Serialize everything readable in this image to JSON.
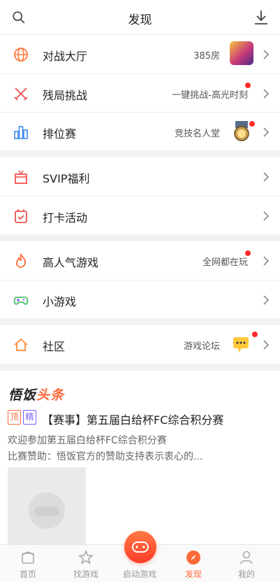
{
  "header": {
    "title": "发现",
    "search_icon": "search-icon",
    "download_icon": "download-icon"
  },
  "groups": [
    {
      "items": [
        {
          "label": "对战大厅",
          "sub": "385房",
          "icon": "globe-icon",
          "thumb": "game-thumbnail"
        },
        {
          "label": "残局挑战",
          "sub": "一键挑战-高光时刻",
          "icon": "crossed-swords-icon",
          "dot": true
        },
        {
          "label": "排位赛",
          "sub": "竞技名人堂",
          "icon": "bar-chart-icon",
          "thumb": "medal-icon",
          "dot": true
        }
      ]
    },
    {
      "items": [
        {
          "label": "SVIP福利",
          "icon": "gift-icon"
        },
        {
          "label": "打卡活动",
          "icon": "calendar-check-icon"
        }
      ]
    },
    {
      "items": [
        {
          "label": "高人气游戏",
          "sub": "全网都在玩",
          "icon": "flame-icon",
          "dot": true
        },
        {
          "label": "小游戏",
          "icon": "gamepad-icon"
        }
      ]
    },
    {
      "items": [
        {
          "label": "社区",
          "sub": "游戏论坛",
          "icon": "home-icon",
          "thumb": "chat-bubble-icon",
          "dot": true
        }
      ]
    }
  ],
  "news": {
    "brand_a": "悟饭",
    "brand_b": "头条",
    "tag_top": "顶",
    "tag_fine": "精",
    "headline": "【赛事】第五届白给杯FC综合积分赛",
    "desc": "欢迎参加第五届白给杯FC综合积分赛",
    "desc2": "比赛赞助：悟饭官方的赞助支持表示衷心的..."
  },
  "tabbar": {
    "tabs": [
      {
        "label": "首页",
        "icon": "home-tab-icon"
      },
      {
        "label": "找游戏",
        "icon": "star-icon"
      },
      {
        "label": "启动游戏",
        "icon": "launch-game-icon"
      },
      {
        "label": "发现",
        "icon": "compass-icon",
        "active": true
      },
      {
        "label": "我的",
        "icon": "user-icon"
      }
    ]
  },
  "colors": {
    "accent": "#ff6a3a",
    "badge": "#ff2a2a",
    "purple": "#7a5cff"
  }
}
